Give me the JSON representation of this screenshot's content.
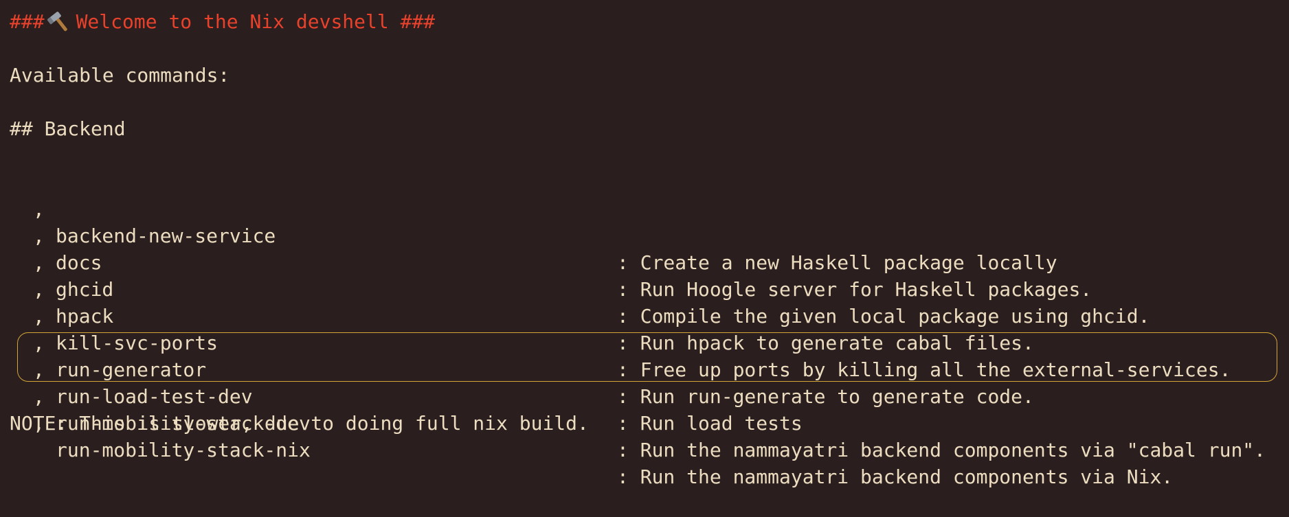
{
  "terminal": {
    "welcome_prefix": "###",
    "welcome_icon": "hammer-icon",
    "welcome_text": "Welcome to the Nix devshell ###",
    "available_commands": "Available commands:",
    "section_backend": "## Backend",
    "bullet": ",",
    "commands": [
      {
        "name": "backend-new-service",
        "desc": ": Create a new Haskell package locally"
      },
      {
        "name": "docs",
        "desc": ": Run Hoogle server for Haskell packages."
      },
      {
        "name": "ghcid",
        "desc": ": Compile the given local package using ghcid."
      },
      {
        "name": "hpack",
        "desc": ": Run hpack to generate cabal files."
      },
      {
        "name": "kill-svc-ports",
        "desc": ": Free up ports by killing all the external-services."
      },
      {
        "name": "run-generator",
        "desc": ": Run run-generate to generate code."
      },
      {
        "name": "run-load-test-dev",
        "desc": ": Run load tests"
      },
      {
        "name": "run-mobility-stack-dev",
        "desc": ": Run the nammayatri backend components via \"cabal run\"."
      },
      {
        "name": "run-mobility-stack-nix",
        "desc": ": Run the nammayatri backend components via Nix."
      }
    ],
    "note": "NOTE: This is slower, due to doing full nix build.",
    "colors": {
      "background": "#2a1f1e",
      "text": "#ecdcc0",
      "welcome": "#e8412c",
      "highlight": "#d4a637"
    }
  }
}
